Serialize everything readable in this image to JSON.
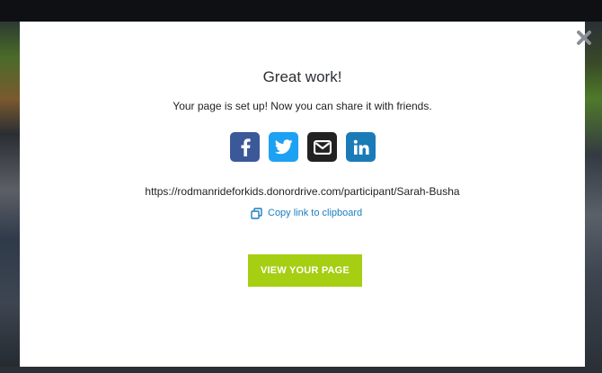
{
  "modal": {
    "title": "Great work!",
    "subtitle": "Your page is set up! Now you can share it with friends.",
    "share_url": "https://rodmanrideforkids.donordrive.com/participant/Sarah-Busha",
    "copy_link_label": "Copy link to clipboard",
    "view_button_label": "VIEW YOUR PAGE",
    "close_icon": "close-icon",
    "share_buttons": [
      {
        "name": "facebook",
        "icon": "facebook-icon",
        "color": "#3b5998"
      },
      {
        "name": "twitter",
        "icon": "twitter-icon",
        "color": "#1da1f2"
      },
      {
        "name": "email",
        "icon": "envelope-icon",
        "color": "#222222"
      },
      {
        "name": "linkedin",
        "icon": "linkedin-icon",
        "color": "#1b7bb7"
      }
    ],
    "colors": {
      "accent_button": "#a6ce12",
      "link": "#1a7fc1",
      "close_icon": "#8a8f96"
    }
  }
}
